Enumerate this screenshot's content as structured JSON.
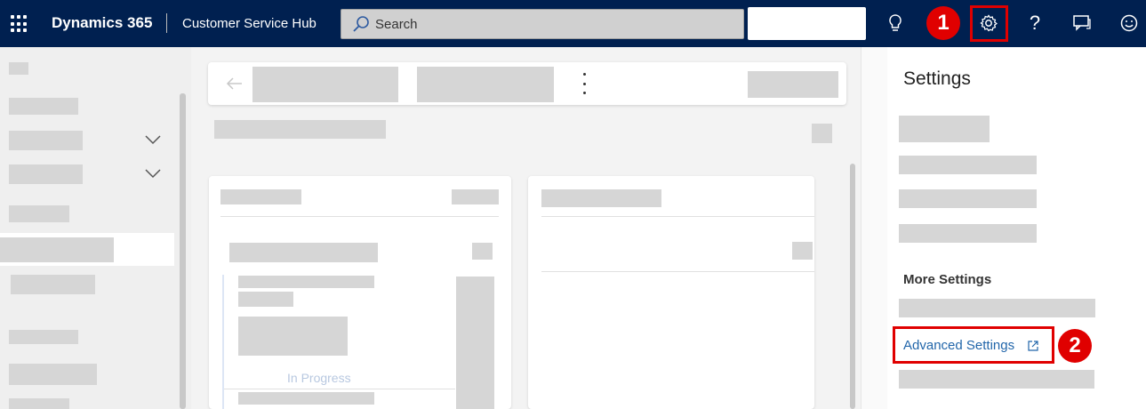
{
  "topbar": {
    "brand": "Dynamics 365",
    "app_name": "Customer Service Hub",
    "search_placeholder": "Search",
    "icons": [
      "waffle-icon",
      "lightbulb-icon",
      "settings-icon",
      "help-icon",
      "feedback-icon",
      "smiley-icon"
    ]
  },
  "callouts": {
    "step1": "1",
    "step2": "2"
  },
  "settings_panel": {
    "title": "Settings",
    "more_settings": "More Settings",
    "advanced_settings": "Advanced Settings"
  },
  "main": {
    "status_text": "In Progress"
  },
  "colors": {
    "topbar": "#002050",
    "highlight": "#e00000",
    "link": "#2266aa"
  }
}
